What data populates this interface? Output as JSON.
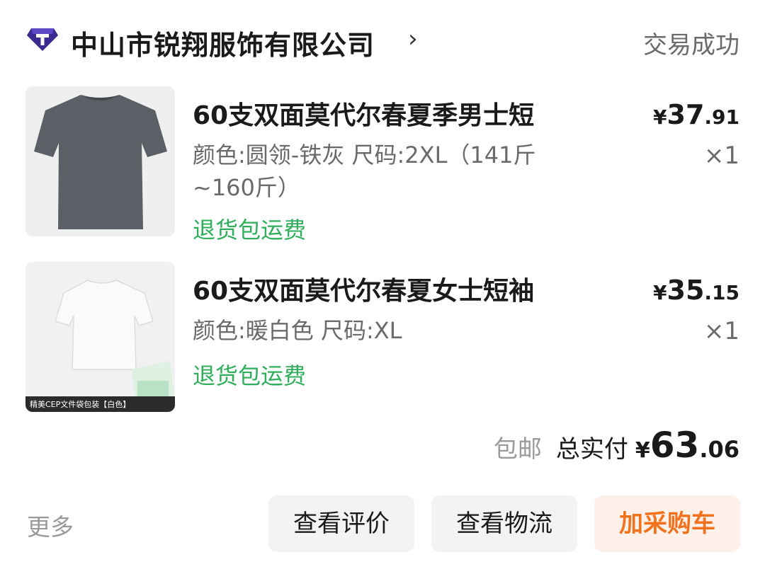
{
  "shop": {
    "name": "中山市锐翔服饰有限公司",
    "arrow": "›",
    "status": "交易成功",
    "logo_icon": "shop-gem-icon",
    "logo_color": "#3b2a8f"
  },
  "items": [
    {
      "title": "60支双面莫代尔春夏季男士短",
      "spec": "颜色:圆领-铁灰 尺码:2XL（141斤~160斤）",
      "tag": "退货包运费",
      "price_currency": "¥",
      "price_int": "37",
      "price_dec": ".91",
      "qty": "×1",
      "thumb_icon": "gray-tshirt-image"
    },
    {
      "title": "60支双面莫代尔春夏女士短袖",
      "spec": "颜色:暖白色 尺码:XL",
      "tag": "退货包运费",
      "price_currency": "¥",
      "price_int": "35",
      "price_dec": ".15",
      "qty": "×1",
      "thumb_icon": "white-tshirt-image",
      "thumb_caption": "精美CEP文件袋包装【白色】"
    }
  ],
  "summary": {
    "shipping": "包邮",
    "total_label": "总实付",
    "currency": "¥",
    "total_int": "63",
    "total_dec": ".06"
  },
  "actions": {
    "more": "更多",
    "review": "查看评价",
    "logistics": "查看物流",
    "add_cart": "加采购车"
  },
  "colors": {
    "accent": "#f2711c",
    "tag_green": "#2fae5b"
  }
}
